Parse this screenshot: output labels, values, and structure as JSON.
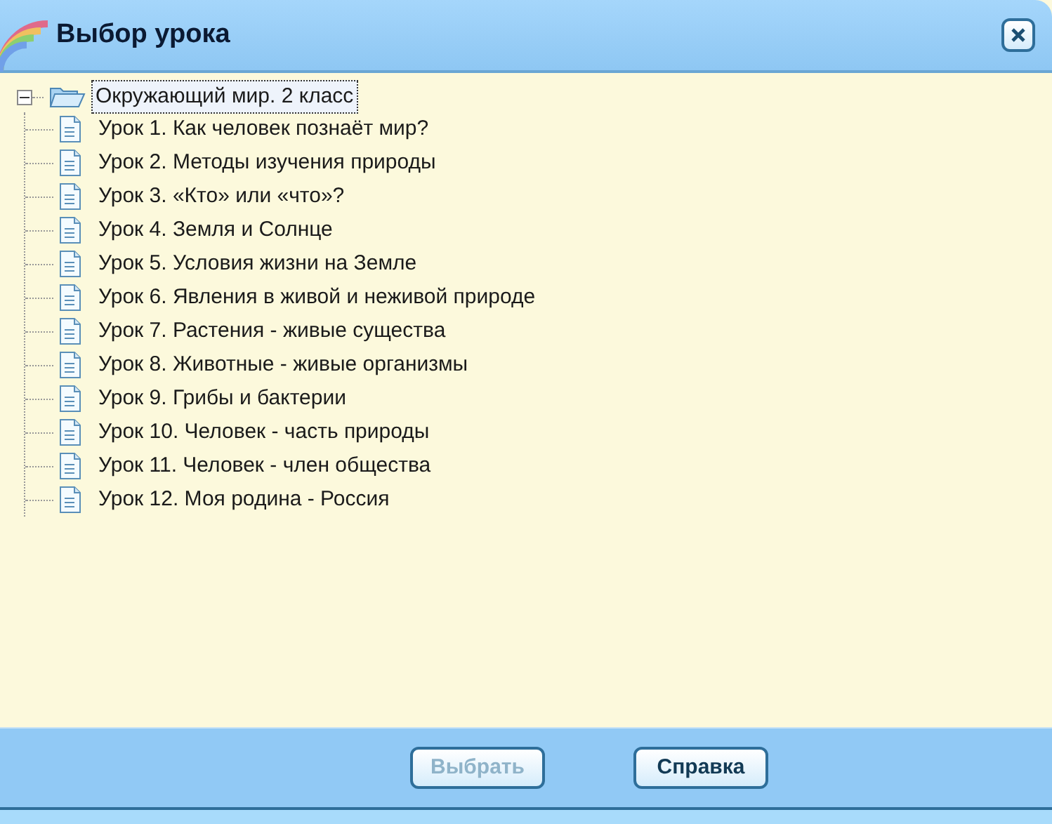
{
  "window": {
    "title": "Выбор урока"
  },
  "tree": {
    "label": "Окружающий мир. 2 класс",
    "expanded": true,
    "selected": true,
    "children": [
      {
        "label": "Урок 1. Как человек познаёт мир?"
      },
      {
        "label": "Урок 2. Методы изучения природы"
      },
      {
        "label": "Урок 3. «Кто» или «что»?"
      },
      {
        "label": "Урок 4. Земля и Солнце"
      },
      {
        "label": "Урок 5. Условия жизни на Земле"
      },
      {
        "label": "Урок 6. Явления в живой и неживой природе"
      },
      {
        "label": "Урок 7. Растения - живые существа"
      },
      {
        "label": "Урок 8. Животные - живые организмы"
      },
      {
        "label": "Урок 9. Грибы и бактерии"
      },
      {
        "label": "Урок 10. Человек - часть природы"
      },
      {
        "label": "Урок 11. Человек - член общества"
      },
      {
        "label": "Урок 12. Моя родина - Россия"
      }
    ]
  },
  "buttons": [
    {
      "label": "Выбрать",
      "disabled": true
    },
    {
      "label": "Справка",
      "disabled": false
    }
  ]
}
